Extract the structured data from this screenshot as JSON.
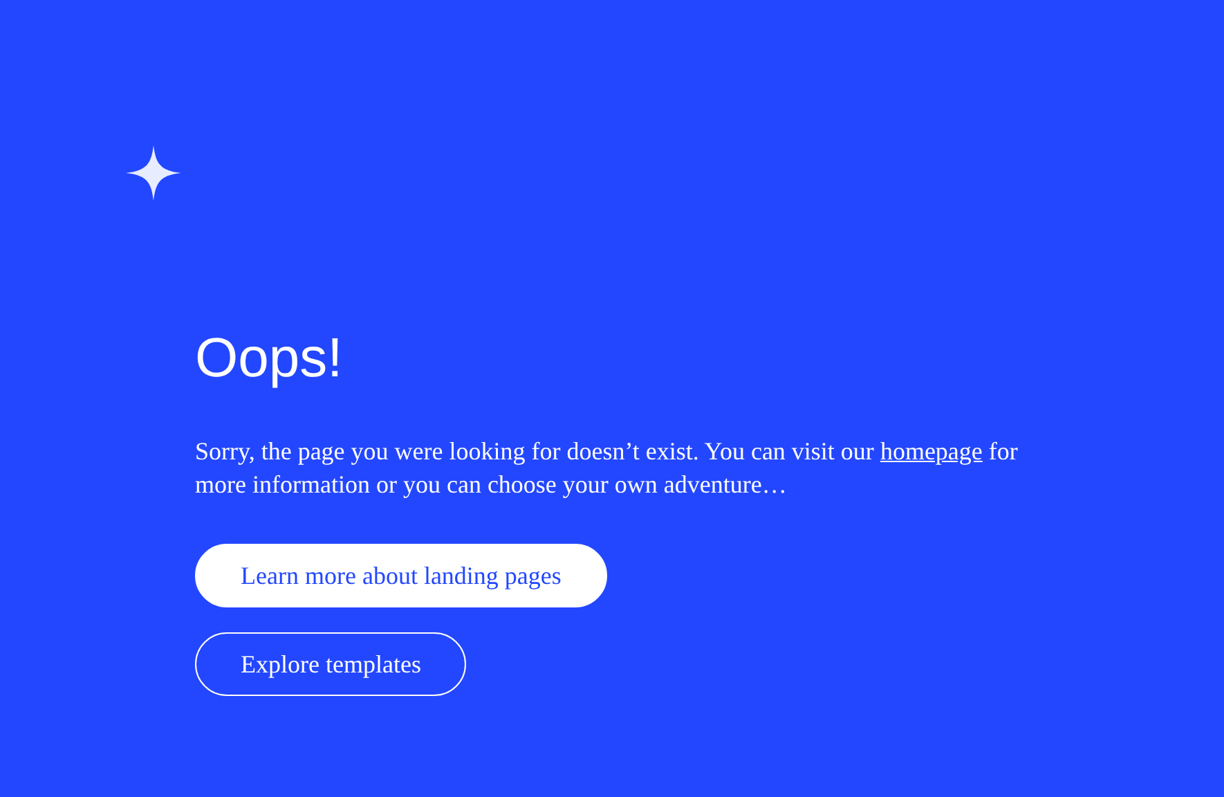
{
  "heading": "Oops!",
  "message": {
    "before": "Sorry, the page you were looking for doesn’t exist. You can visit our ",
    "link": "homepage",
    "after": " for more information or you can choose your own adventure…"
  },
  "buttons": [
    {
      "label": "Learn more about landing pages",
      "kind": "filled"
    },
    {
      "label": "Explore templates",
      "kind": "outline"
    }
  ]
}
